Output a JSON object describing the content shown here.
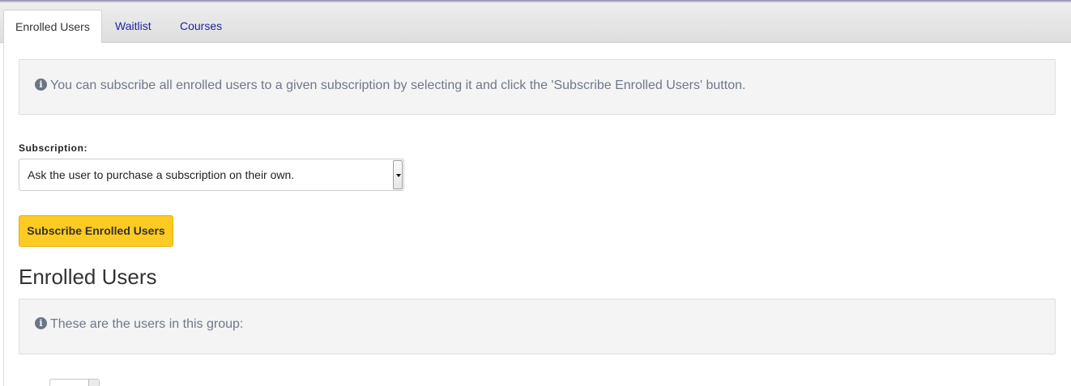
{
  "tabs": [
    {
      "label": "Enrolled Users",
      "active": true
    },
    {
      "label": "Waitlist",
      "active": false
    },
    {
      "label": "Courses",
      "active": false
    }
  ],
  "subscribe_info": {
    "icon": "info-circle-icon",
    "text": "You can subscribe all enrolled users to a given subscription by selecting it and click the 'Subscribe Enrolled Users' button."
  },
  "subscription": {
    "label": "Subscription:",
    "selected": "Ask the user to purchase a subscription on their own."
  },
  "subscribe_button": "Subscribe Enrolled Users",
  "enrolled": {
    "heading": "Enrolled Users",
    "info_icon": "info-circle-icon",
    "info_text": "These are the users in this group:"
  },
  "colors": {
    "accent_button": "#fdcb21",
    "link": "#1f1fa3",
    "info_text": "#6f7888"
  }
}
